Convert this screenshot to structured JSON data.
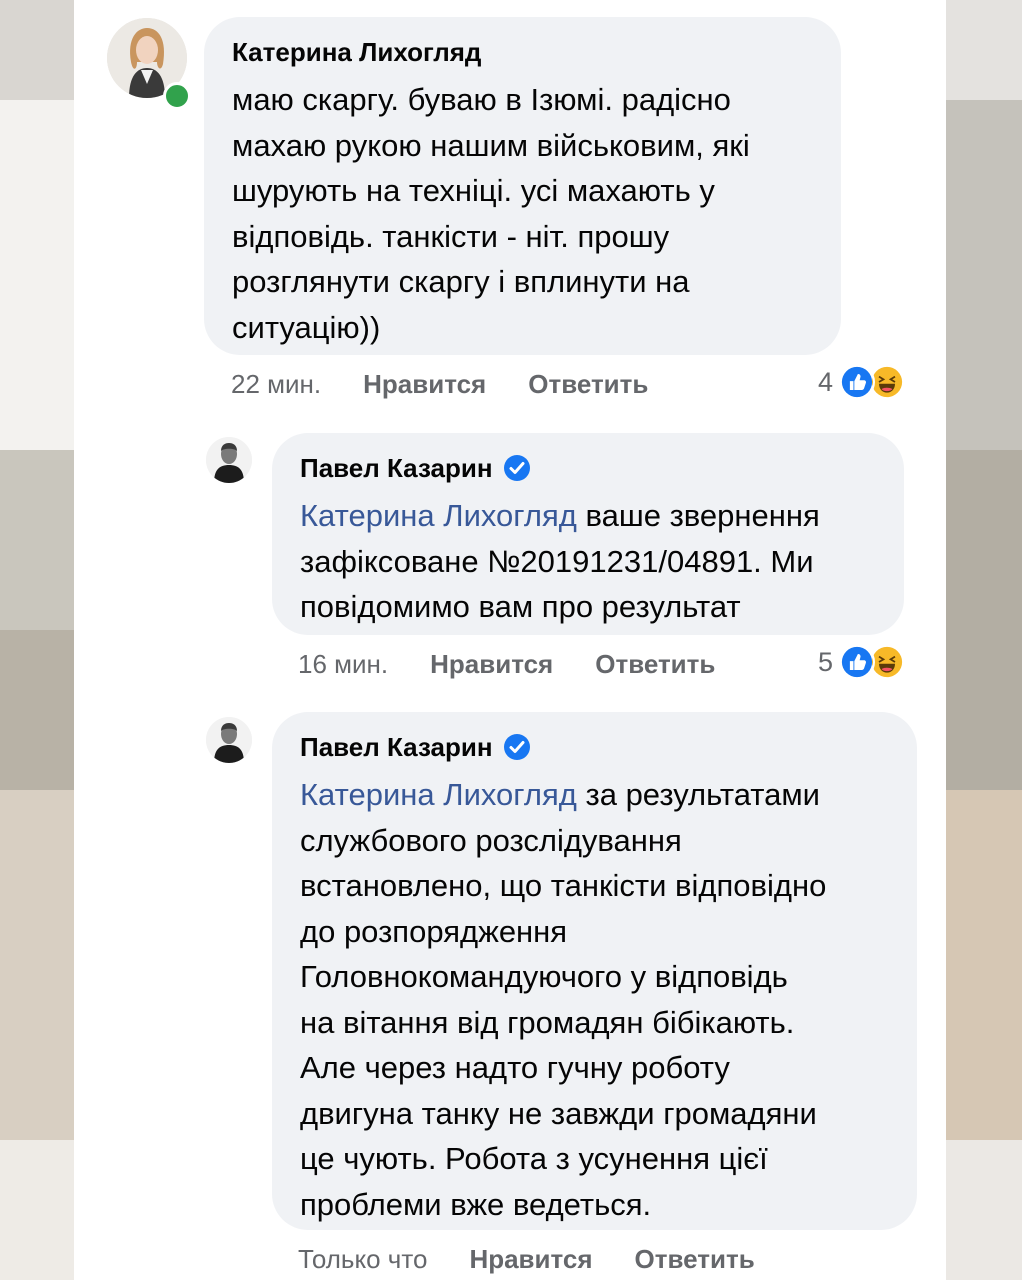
{
  "colors": {
    "mention": "#385898",
    "bubble": "#f0f2f5",
    "like_blue": "#1877f2",
    "haha_yellow": "#f7b928",
    "online_green": "#31a24c"
  },
  "comments": [
    {
      "author": "Катерина Лихогляд",
      "online": true,
      "verified": false,
      "mention": "",
      "lines": [
        "маю скаргу. буваю в Ізюмі. радісно",
        "махаю рукою нашим військовим, які",
        "шурують на техніці. усі махають у",
        "відповідь. танкісти - ніт. прошу",
        "розглянути скаргу і вплинути на",
        "ситуацію))"
      ],
      "time": "22 мин.",
      "like_label": "Нравится",
      "reply_label": "Ответить",
      "reaction_count": "4",
      "reactions": [
        "like-icon",
        "haha-icon"
      ]
    },
    {
      "author": "Павел Казарин",
      "online": false,
      "verified": true,
      "mention": "Катерина Лихогляд",
      "first_line_rest": " ваше звернення",
      "lines": [
        "зафіксоване №20191231/04891. Ми",
        "повідомимо вам про результат"
      ],
      "time": "16 мин.",
      "like_label": "Нравится",
      "reply_label": "Ответить",
      "reaction_count": "5",
      "reactions": [
        "like-icon",
        "haha-icon"
      ]
    },
    {
      "author": "Павел Казарин",
      "online": false,
      "verified": true,
      "mention": "Катерина Лихогляд",
      "first_line_rest": " за результатами",
      "lines": [
        "службового розслідування",
        "встановлено, що танкісти відповідно",
        "до розпорядження",
        "Головнокомандуючого у відповідь",
        "на вітання від громадян бібікають.",
        "Але через надто гучну роботу",
        "двигуна танку не завжди громадяни",
        "це чують. Робота з усунення цієї",
        "проблеми вже ведеться."
      ],
      "time": "Только что",
      "like_label": "Нравится",
      "reply_label": "Ответить"
    }
  ]
}
